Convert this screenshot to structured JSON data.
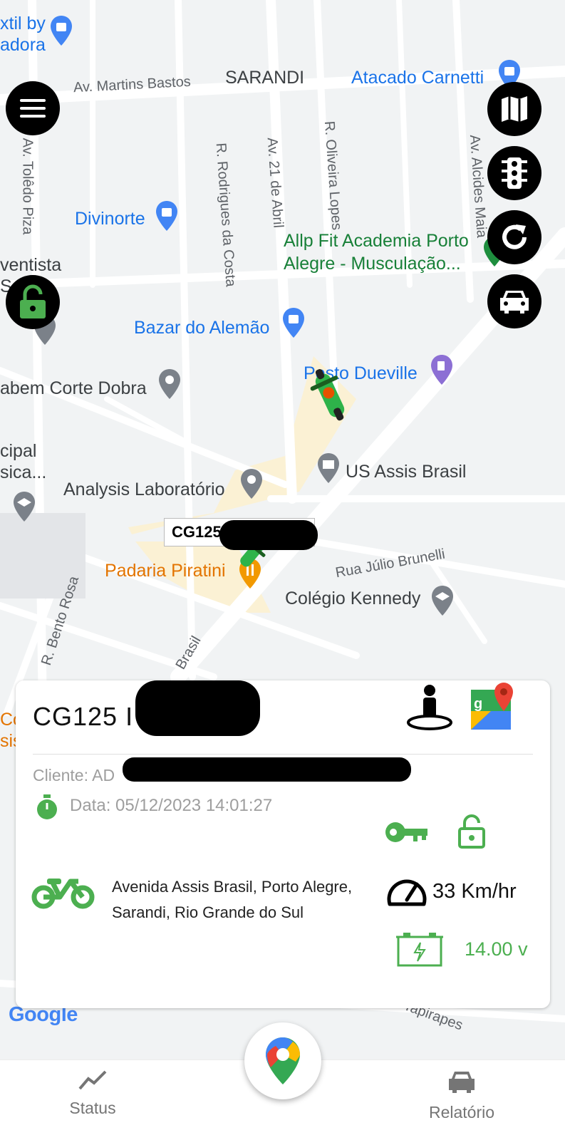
{
  "map": {
    "streets": [
      "Av. Martins Bastos",
      "Av. Tolêdo Piza",
      "R. Rodrigues da Costa",
      "Av. 21 de Abril",
      "R. Oliveira Lopes",
      "Av. Alcides Maia",
      "R. Bento Rosa",
      "Rua Júlio Brunelli",
      "Brasil",
      "R. Tapirapes"
    ],
    "neighborhood": "SARANDI",
    "places": {
      "textil": "xtil by\nadora",
      "atacado": "Atacado Carnetti",
      "divinorte": "Divinorte",
      "allp_fit": "Allp Fit Academia Porto\nAlegre - Musculação...",
      "adventista": "ventista\nS",
      "bazar": "Bazar do Alemão",
      "posto": "Posto Dueville",
      "corte": "abem Corte Dobra",
      "municipal": "cipal\nsica...",
      "us_assis": "US Assis Brasil",
      "analysis": "Analysis Laboratório",
      "padaria": "Padaria Piratini",
      "colegio": "Colégio Kennedy",
      "co_left": "Co\nsis"
    },
    "vehicle_marker_label": "CG125",
    "google_logo": "Google"
  },
  "fabs": {
    "menu": "menu-icon",
    "lock": "lock-open-icon",
    "map_type": "map-icon",
    "traffic": "traffic-light-icon",
    "refresh": "refresh-icon",
    "car": "car-icon"
  },
  "card": {
    "title": "CG125 I",
    "client": "Cliente: AD",
    "date": "Data: 05/12/2023 14:01:27",
    "address": "Avenida Assis Brasil, Porto Alegre, Sarandi, Rio Grande do Sul",
    "speed": "33 Km/hr",
    "voltage": "14.00 v",
    "accent_color": "#4caf50"
  },
  "bottom_nav": {
    "status_label": "Status",
    "report_label": "Relatório"
  }
}
